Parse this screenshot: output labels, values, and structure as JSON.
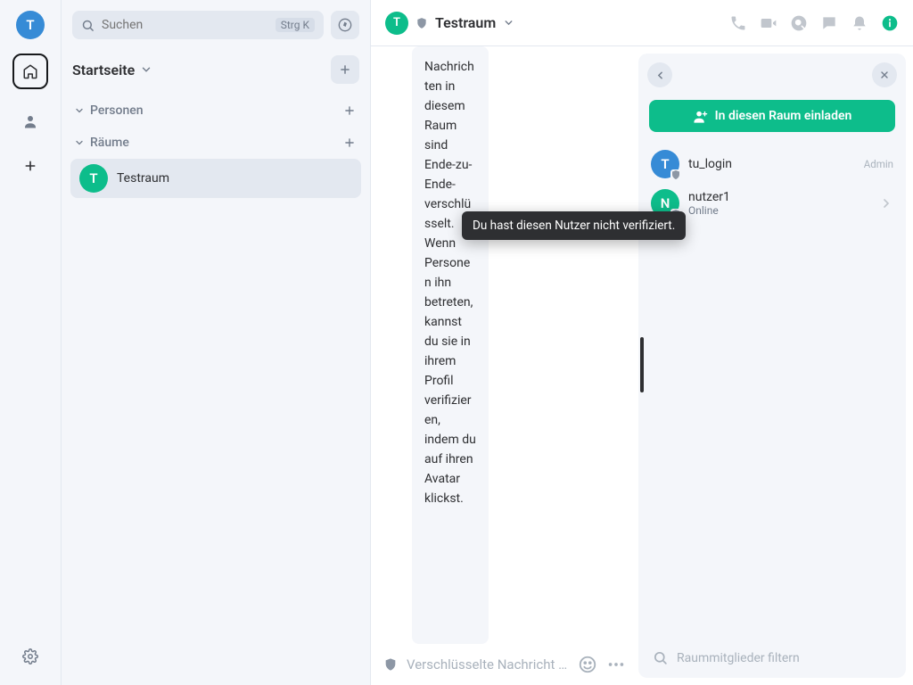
{
  "rail": {
    "avatar_letter": "T"
  },
  "search": {
    "placeholder": "Suchen",
    "shortcut": "Strg K"
  },
  "home": {
    "title": "Startseite"
  },
  "sections": {
    "people": "Personen",
    "rooms": "Räume"
  },
  "room_list": {
    "testraum_letter": "T",
    "testraum_label": "Testraum"
  },
  "header": {
    "room_letter": "T",
    "room_name": "Testraum"
  },
  "timeline": {
    "info_text": "Nachrichten in diesem Raum sind Ende-zu-Ende-verschlüsselt. Wenn Personen ihn betreten, kannst du sie in ihrem Profil verifizieren, indem du auf ihren Avatar klickst."
  },
  "tooltip": {
    "text": "Du hast diesen Nutzer nicht verifiziert."
  },
  "composer": {
    "placeholder": "Verschlüsselte Nachricht senden …"
  },
  "panel": {
    "invite_label": "In diesen Raum einladen",
    "member1": {
      "letter": "T",
      "name": "tu_login",
      "role": "Admin"
    },
    "member2": {
      "letter": "N",
      "name": "nutzer1",
      "status": "Online"
    },
    "filter_placeholder": "Raummitglieder filtern"
  }
}
